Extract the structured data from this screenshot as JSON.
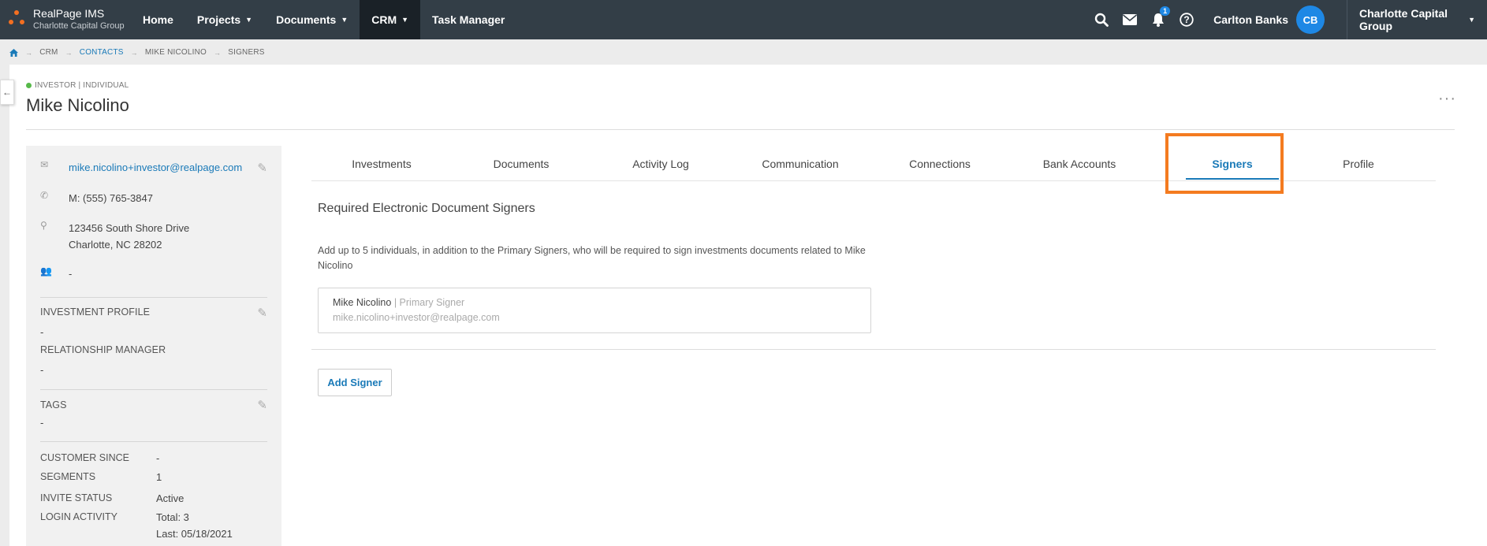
{
  "brand": {
    "title": "RealPage IMS",
    "subtitle": "Charlotte Capital Group",
    "accent": "#f36f21"
  },
  "nav": {
    "home": "Home",
    "projects": "Projects",
    "documents": "Documents",
    "crm": "CRM",
    "task_manager": "Task Manager"
  },
  "header_tools": {
    "notification_count": "1",
    "user_name": "Carlton Banks",
    "user_initials": "CB",
    "org": "Charlotte Capital Group"
  },
  "breadcrumb": [
    "CRM",
    "CONTACTS",
    "MIKE NICOLINO",
    "SIGNERS"
  ],
  "contact": {
    "status": "INVESTOR | INDIVIDUAL",
    "name": "Mike Nicolino"
  },
  "sidebar": {
    "email": "mike.nicolino+investor@realpage.com",
    "phone": "M: (555) 765-3847",
    "address_line1": "123456 South Shore Drive",
    "address_line2": "Charlotte, NC 28202",
    "group": "-",
    "investment_profile_label": "INVESTMENT PROFILE",
    "investment_profile_value": "-",
    "relationship_manager_label": "RELATIONSHIP MANAGER",
    "relationship_manager_value": "-",
    "tags_label": "TAGS",
    "tags_value": "-",
    "customer_since_label": "CUSTOMER SINCE",
    "customer_since_value": "-",
    "segments_label": "SEGMENTS",
    "segments_value": "1",
    "invite_status_label": "INVITE STATUS",
    "invite_status_value": "Active",
    "login_activity_label": "LOGIN ACTIVITY",
    "login_total": "Total: 3",
    "login_last": "Last: 05/18/2021"
  },
  "tabs": {
    "investments": "Investments",
    "documents": "Documents",
    "activity_log": "Activity Log",
    "communication": "Communication",
    "connections": "Connections",
    "bank_accounts": "Bank Accounts",
    "signers": "Signers",
    "profile": "Profile"
  },
  "signers": {
    "title": "Required Electronic Document Signers",
    "description": "Add up to 5 individuals, in addition to the Primary Signers, who will be required to sign investments documents related to Mike Nicolino",
    "primary_name": "Mike Nicolino",
    "primary_role": "| Primary Signer",
    "primary_email": "mike.nicolino+investor@realpage.com",
    "add_button": "Add Signer"
  },
  "colors": {
    "link": "#1a7ab8",
    "highlight": "#f47b20",
    "status_active": "#57b94a"
  }
}
